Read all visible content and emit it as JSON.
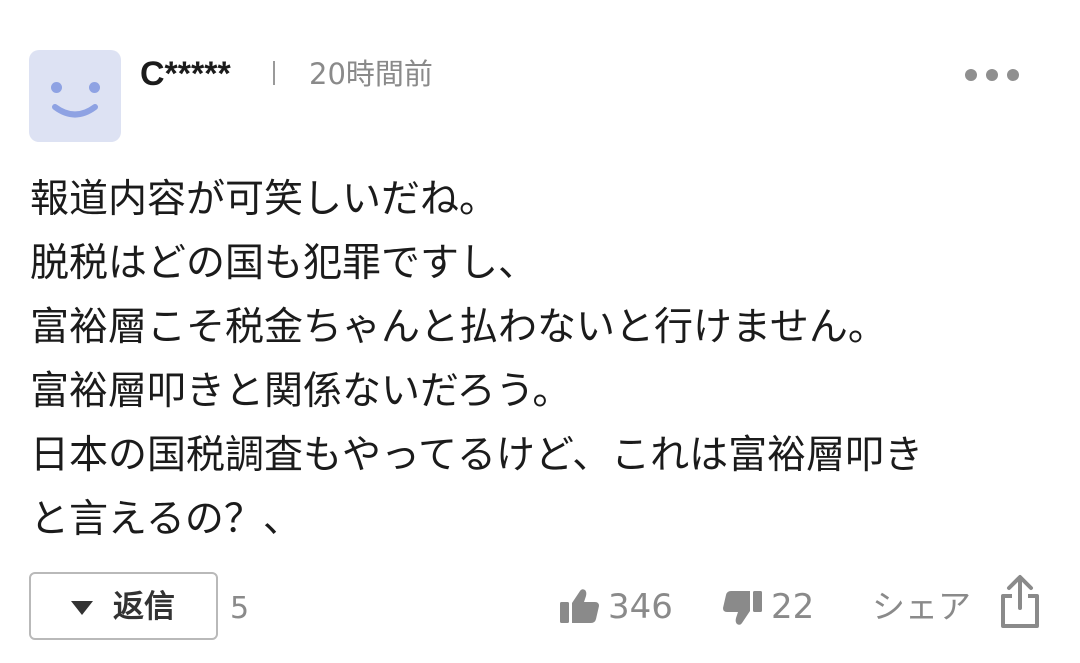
{
  "comment": {
    "username": "C*****",
    "separator": "|",
    "timestamp": "20時間前",
    "body_lines": [
      "報道内容が可笑しいだね。",
      "脱税はどの国も犯罪ですし、",
      "富裕層こそ税金ちゃんと払わないと行けません。",
      "富裕層叩きと関係ないだろう。",
      "日本の国税調査もやってるけど、これは富裕層叩き",
      "と言えるの？、"
    ],
    "icons": {
      "avatar": "smiley-avatar",
      "more": "more-dots-icon",
      "like": "thumbs-up-icon",
      "dislike": "thumbs-down-icon",
      "share": "share-icon",
      "reply_toggle": "triangle-down-icon"
    }
  },
  "actions": {
    "reply_label": "返信",
    "reply_count": "5",
    "like_count": "346",
    "dislike_count": "22",
    "share_label": "シェア"
  },
  "colors": {
    "avatar_bg": "#dde2f3",
    "avatar_face": "#8ea2e3",
    "muted_text": "#8a8a8a",
    "body_text": "#1b1b1b"
  }
}
